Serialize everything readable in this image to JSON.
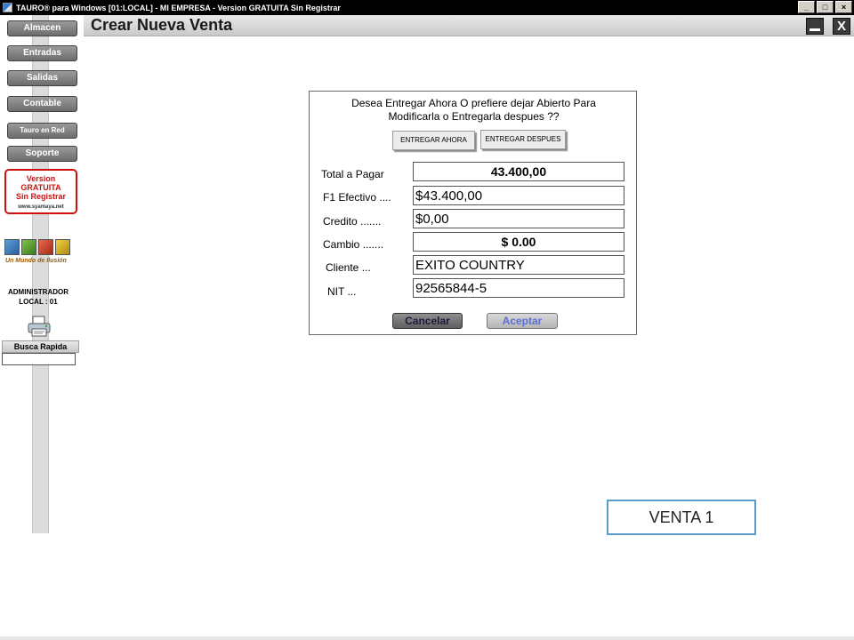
{
  "window": {
    "title": "TAURO® para Windows  [01:LOCAL] - MI EMPRESA - Version GRATUITA Sin Registrar",
    "controls": [
      "_",
      "□",
      "×"
    ]
  },
  "header": {
    "title": "Crear Nueva Venta",
    "close_label": "X"
  },
  "sidebar": {
    "items": [
      {
        "label": "Almacen"
      },
      {
        "label": "Entradas"
      },
      {
        "label": "Salidas"
      },
      {
        "label": "Contable"
      },
      {
        "label": "Tauro en Red"
      },
      {
        "label": "Soporte"
      }
    ],
    "promo": {
      "line1": "Version",
      "line2": "GRATUITA",
      "line3": "Sin Registrar",
      "url": "www.syamaya.net"
    },
    "logo_tagline": "Un Mundo de Ilusión",
    "user_role": "ADMINISTRADOR",
    "location": "LOCAL : 01",
    "quick_search": {
      "label": "Busca Rapida",
      "value": ""
    }
  },
  "dialog": {
    "question_line1": "Desea Entregar Ahora O prefiere dejar Abierto Para",
    "question_line2": "Modificarla o Entregarla despues ??",
    "deliver_now_label": "ENTREGAR AHORA",
    "deliver_later_label": "ENTREGAR DESPUES",
    "fields": {
      "total_label": "Total a Pagar",
      "total_value": "43.400,00",
      "cash_label": "F1  Efectivo ....",
      "cash_value": "$43.400,00",
      "credit_label": "Credito .......",
      "credit_value": "$0,00",
      "change_label": "Cambio .......",
      "change_value": "$ 0.00",
      "client_label": "Cliente ...",
      "client_value": "EXITO COUNTRY",
      "nit_label": "NIT ...",
      "nit_value": "92565844-5"
    },
    "cancel_label": "Cancelar",
    "accept_label": "Aceptar"
  },
  "caption": {
    "label": "VENTA  1"
  },
  "colors": {
    "titlebar": "#000000",
    "promo_red": "#d01010",
    "caption_border": "#5b9bc8",
    "accept_text": "#5a6fd6"
  }
}
